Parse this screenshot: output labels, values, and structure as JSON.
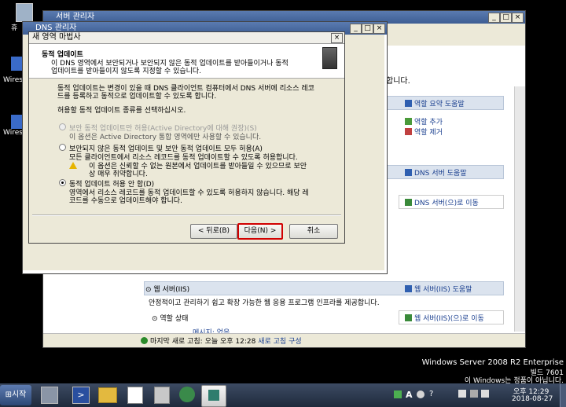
{
  "desktop": {
    "icons": [
      {
        "label": "휴"
      },
      {
        "label": "Wires"
      },
      {
        "label": "Wires"
      }
    ],
    "watermark": {
      "line1": "Windows Server 2008 R2 Enterprise",
      "line2": "빌드 7601",
      "line3": "이 Windows는 정품이 아닙니다."
    }
  },
  "server_manager": {
    "title": "서버 관리자",
    "partial_text": "합니다.",
    "role_summary_help": "역할 요약 도움말",
    "add_role": "역할 추가",
    "remove_role": "역할 제거",
    "dns_help": "DNS 서버 도움말",
    "dns_go": "DNS 서버(으)로 이동",
    "web_section": "웹 서버(IIS)",
    "web_help": "웹 서버(IIS) 도움말",
    "web_desc": "안정적이고 관리하기 쉽고 확장 가능한 웹 응용 프로그램 인프라를 제공합니다.",
    "web_go": "웹 서버(IIS)(으)로 이동",
    "role_status": "역할 상태",
    "messages": "메시지: 없음",
    "status_prefix": "마지막 새로 고침: 오늘 오후 12:28",
    "refresh_config": "새로 고침 구성"
  },
  "dns_manager": {
    "title": "DNS 관리자"
  },
  "wizard": {
    "title": "새 영역 마법사",
    "header_title": "동적 업데이트",
    "header_desc1": "이 DNS 영역에서 보안되거나 보안되지 않은 동적 업데이트를 받아들이거나 동적",
    "header_desc2": "업데이트를 받아들이지 않도록 지정할 수 있습니다.",
    "intro1": "동적 업데이트는 변경이 있을 때 DNS 클라이언트 컴퓨터에서 DNS 서버에 리소스 레코",
    "intro2": "드를 등록하고 동적으로 업데이트할 수 있도록 합니다.",
    "select_prompt": "허용할 동적 업데이트 종류를 선택하십시오.",
    "opt1_label": "보안 동적 업데이트만 허용(Active Directory에 대해 권장)(S)",
    "opt1_desc": "이 옵션은 Active Directory 통합 영역에만 사용할 수 있습니다.",
    "opt2_label": "보안되지 않은 동적 업데이트 및 보안 동적 업데이트 모두 허용(A)",
    "opt2_desc": "모든 클라이언트에서 리소스 레코드를 동적 업데이트할 수 있도록 허용합니다.",
    "warn1": "이 옵션은 신뢰할 수 없는 원본에서 업데이트를 받아들일 수 있으므로 보안",
    "warn2": "상 매우 취약합니다.",
    "opt3_label": "동적 업데이트 허용 안 함(D)",
    "opt3_desc1": "영역에서 리소스 레코드를 동적 업데이트할 수 있도록 허용하지 않습니다. 해당 레",
    "opt3_desc2": "코드를 수동으로 업데이트해야 합니다.",
    "back": "< 뒤로(B)",
    "next": "다음(N) >",
    "cancel": "취소",
    "selected_option": "opt3"
  },
  "taskbar": {
    "start": "시작",
    "lang": "A",
    "clock_time": "오후 12:29",
    "clock_date": "2018-08-27"
  }
}
